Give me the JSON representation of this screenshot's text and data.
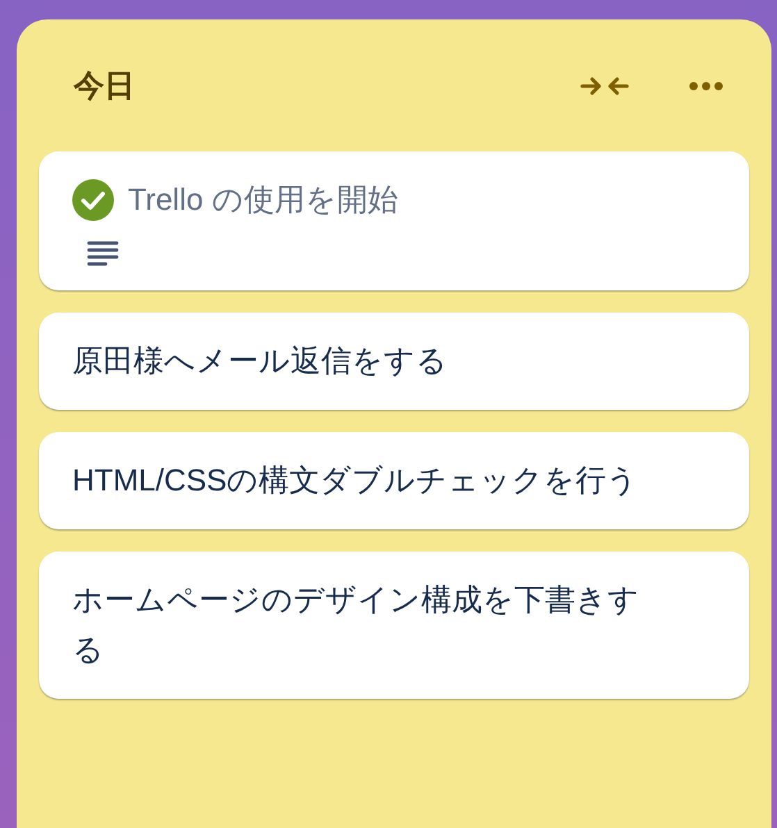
{
  "list": {
    "title": "今日",
    "cards": [
      {
        "title": "Trello の使用を開始",
        "completed": true,
        "has_description": true
      },
      {
        "title": "原田様へメール返信をする",
        "completed": false,
        "has_description": false
      },
      {
        "title": "HTML/CSSの構文ダブルチェックを行う",
        "completed": false,
        "has_description": false
      },
      {
        "title": "ホームページのデザイン構成を下書きする",
        "completed": false,
        "has_description": false
      }
    ]
  }
}
